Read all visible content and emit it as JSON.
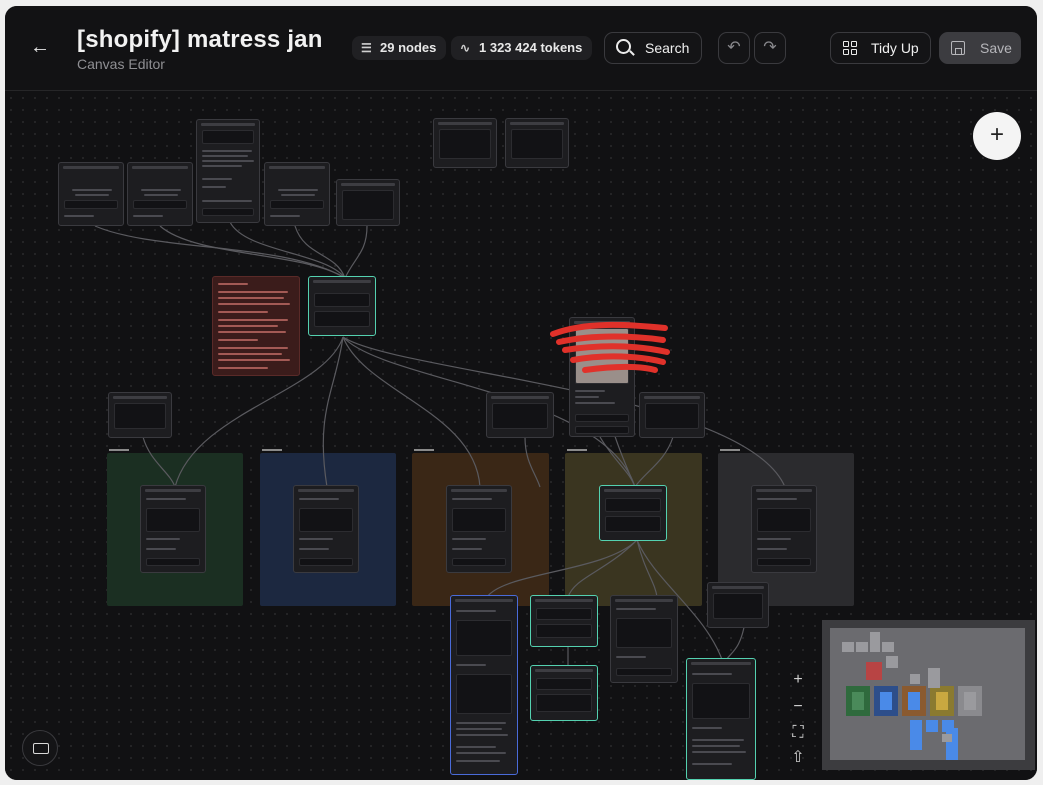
{
  "header": {
    "title": "[shopify] matress jan",
    "subtitle": "Canvas Editor",
    "back_icon": "arrow-left-icon",
    "nodes_count": "29 nodes",
    "tokens_count": "1 323 424 tokens",
    "search_label": "Search",
    "tidy_label": "Tidy Up",
    "save_label": "Save"
  },
  "colors": {
    "background": "#111113",
    "selected_node": "#54d1b0",
    "active_node": "#4a6bd9",
    "group_green": "#1b2f22",
    "group_blue": "#1c2840",
    "group_orange": "#3a2716",
    "group_olive": "#3a3520",
    "group_gray": "#2b2b2e",
    "sticky_note": "#3b1c1b",
    "scribble": "#e0312a"
  },
  "canvas": {
    "add_button_label": "+",
    "zoom_in_label": "+",
    "zoom_out_label": "−"
  }
}
